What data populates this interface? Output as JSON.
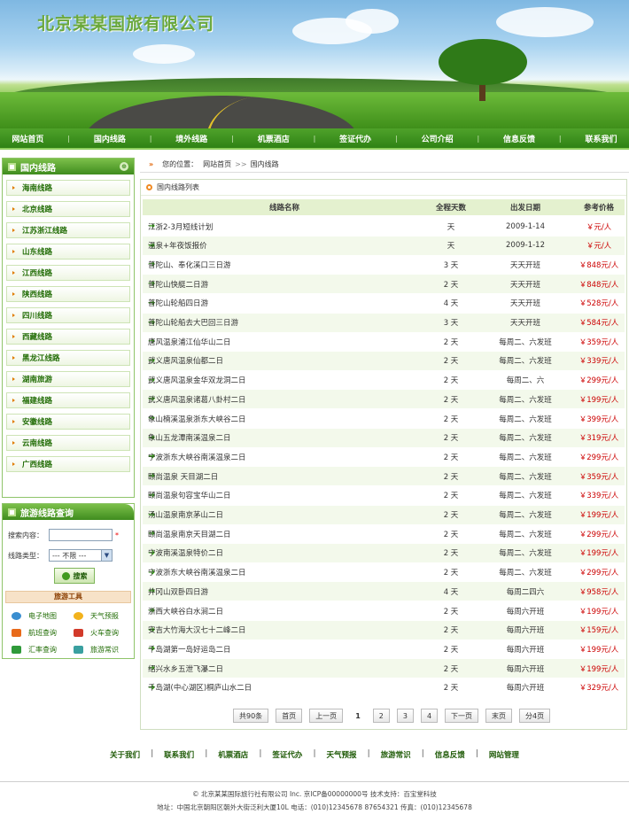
{
  "header": {
    "logo_text": "北京某某国旅有限公司"
  },
  "nav": [
    "网站首页",
    "国内线路",
    "境外线路",
    "机票酒店",
    "签证代办",
    "公司介绍",
    "信息反馈",
    "联系我们"
  ],
  "sidebar": {
    "title": "国内线路",
    "routes": [
      "海南线路",
      "北京线路",
      "江苏浙江线路",
      "山东线路",
      "江西线路",
      "陕西线路",
      "四川线路",
      "西藏线路",
      "黑龙江线路",
      "湖南旅游",
      "福建线路",
      "安徽线路",
      "云南线路",
      "广西线路"
    ]
  },
  "search": {
    "title": "旅游线路查询",
    "content_label": "搜索内容：",
    "content_value": "",
    "required_mark": "*",
    "type_label": "线路类型：",
    "type_value": "--- 不限 ---",
    "button_label": "搜索",
    "tools_title": "旅游工具",
    "tools": [
      "电子地图",
      "天气预报",
      "航班查询",
      "火车查询",
      "汇率查询",
      "旅游常识"
    ]
  },
  "breadcrumb": {
    "prefix": "您的位置：",
    "home": "网站首页",
    "separator": ">>",
    "current": "国内线路"
  },
  "list": {
    "title": "国内线路列表",
    "columns": [
      "线路名称",
      "全程天数",
      "出发日期",
      "参考价格"
    ],
    "rows": [
      [
        "江浙2-3月短线计划",
        "天",
        "2009-1-14",
        "￥元/人"
      ],
      [
        "温泉+年夜饭报价",
        "天",
        "2009-1-12",
        "￥元/人"
      ],
      [
        "普陀山、奉化溪口三日游",
        "3 天",
        "天天开班",
        "￥848元/人"
      ],
      [
        "普陀山快艇二日游",
        "2 天",
        "天天开班",
        "￥848元/人"
      ],
      [
        "普陀山轮船四日游",
        "4 天",
        "天天开班",
        "￥528元/人"
      ],
      [
        "普陀山轮船去大巴回三日游",
        "3 天",
        "天天开班",
        "￥584元/人"
      ],
      [
        "唐风温泉浦江仙华山二日",
        "2 天",
        "每周二、六发班",
        "￥359元/人"
      ],
      [
        "武义唐风温泉仙都二日",
        "2 天",
        "每周二、六发班",
        "￥339元/人"
      ],
      [
        "武义唐风温泉金华双龙洞二日",
        "2 天",
        "每周二、六",
        "￥299元/人"
      ],
      [
        "武义唐风温泉诸葛八卦村二日",
        "2 天",
        "每周二、六发班",
        "￥199元/人"
      ],
      [
        "象山楠溪温泉浙东大峡谷二日",
        "2 天",
        "每周二、六发班",
        "￥399元/人"
      ],
      [
        "象山五龙潭南溪温泉二日",
        "2 天",
        "每周二、六发班",
        "￥319元/人"
      ],
      [
        "宁波浙东大峡谷南溪温泉二日",
        "2 天",
        "每周二、六发班",
        "￥299元/人"
      ],
      [
        "颐尚温泉 天目湖二日",
        "2 天",
        "每周二、六发班",
        "￥359元/人"
      ],
      [
        "颐尚温泉句容宝华山二日",
        "2 天",
        "每周二、六发班",
        "￥339元/人"
      ],
      [
        "汤山温泉南京茅山二日",
        "2 天",
        "每周二、六发班",
        "￥199元/人"
      ],
      [
        "颐尚温泉南京天目湖二日",
        "2 天",
        "每周二、六发班",
        "￥299元/人"
      ],
      [
        "宁波南溪温泉特价二日",
        "2 天",
        "每周二、六发班",
        "￥199元/人"
      ],
      [
        "宁波浙东大峡谷南溪温泉二日",
        "2 天",
        "每周二、六发班",
        "￥299元/人"
      ],
      [
        "井冈山双卧四日游",
        "4 天",
        "每周二四六",
        "￥958元/人"
      ],
      [
        "浙西大峡谷白水涧二日",
        "2 天",
        "每周六开班",
        "￥199元/人"
      ],
      [
        "安吉大竹海大汉七十二峰二日",
        "2 天",
        "每周六开班",
        "￥159元/人"
      ],
      [
        "千岛湖第一岛好运岛二日",
        "2 天",
        "每周六开班",
        "￥199元/人"
      ],
      [
        "绍兴水乡五泄飞瀑二日",
        "2 天",
        "每周六开班",
        "￥199元/人"
      ],
      [
        "千岛湖(中心湖区)桐庐山水二日",
        "2 天",
        "每周六开班",
        "￥329元/人"
      ]
    ]
  },
  "pager": [
    "共90条",
    "首页",
    "上一页",
    "1",
    "2",
    "3",
    "4",
    "下一页",
    "末页",
    "分4页"
  ],
  "footer": {
    "links": [
      "关于我们",
      "联系我们",
      "机票酒店",
      "签证代办",
      "天气预报",
      "旅游常识",
      "信息反馈",
      "网站管理"
    ],
    "copyright": "© 北京某某国际旅行社有限公司 Inc. 京ICP备00000000号 技术支持：百宝堂科技",
    "address": "地址：中国北京朝阳区朝外大街泛利大厦10L 电话：(010)12345678 87654321 传真：(010)12345678"
  },
  "colors": {
    "accent": "#3f8c1e",
    "price": "#cc0000",
    "nav_bg": "#2f8215"
  }
}
